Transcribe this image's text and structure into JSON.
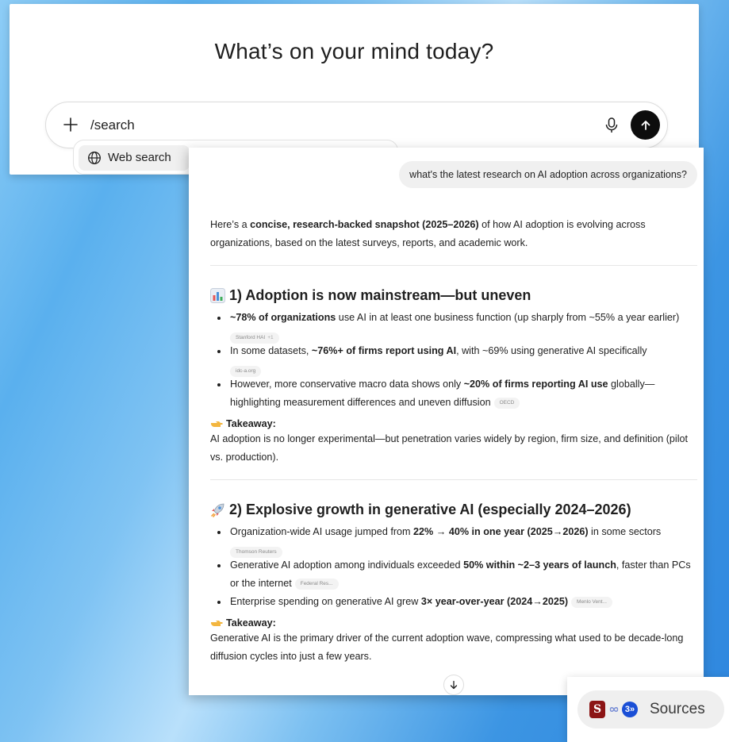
{
  "hero": {
    "title": "What’s on your mind today?"
  },
  "composer": {
    "value": "/search",
    "icons": [
      "plus-icon",
      "mic-icon",
      "arrow-up-icon"
    ]
  },
  "dropdown": {
    "item_label": "Web search",
    "item_icon": "globe-icon"
  },
  "chat": {
    "user_message": "what's the latest research on AI adoption across organizations?",
    "intro_pre": "Here’s a ",
    "intro_bold": "concise, research-backed snapshot (2025–2026)",
    "intro_post": " of how AI adoption is evolving across organizations, based on the latest surveys, reports, and academic work.",
    "section1": {
      "emoji": "bar-chart-icon",
      "title": "1) Adoption is now mainstream—but uneven",
      "b1_bold": "~78% of organizations",
      "b1_text": " use AI in at least one business function (up sharply from ~55% a year earlier)",
      "b1_source": "Stanford HAI",
      "b1_source_more": "+1",
      "b2_pre": "In some datasets, ",
      "b2_bold": "~76%+ of firms report using AI",
      "b2_post": ", with ~69% using generative AI specifically",
      "b2_source": "idc-a.org",
      "b3_pre": "However, more conservative macro data shows only ",
      "b3_bold": "~20% of firms reporting AI use",
      "b3_post": " globally—highlighting measurement differences and uneven diffusion",
      "b3_source": "OECD",
      "takeaway_label": "Takeaway:",
      "takeaway_text": "AI adoption is no longer experimental—but penetration varies widely by region, firm size, and definition (pilot vs. production)."
    },
    "section2": {
      "emoji": "rocket-icon",
      "title": "2) Explosive growth in generative AI (especially 2024–2026)",
      "b1_pre": "Organization-wide AI usage jumped from ",
      "b1_bold": "22% → 40% in one year (2025→2026)",
      "b1_post": " in some sectors",
      "b1_source": "Thomson Reuters",
      "b2_pre": "Generative AI adoption among individuals exceeded ",
      "b2_bold": "50% within ~2–3 years of launch",
      "b2_post": ", faster than PCs or the internet",
      "b2_source": "Federal Res...",
      "b3_pre": "Enterprise spending on generative AI grew ",
      "b3_bold": "3× year-over-year (2024→2025)",
      "b3_source": "Menlo Vent...",
      "takeaway_label": "Takeaway:",
      "takeaway_text": "Generative AI is the primary driver of the current adoption wave, compressing what used to be decade-long diffusion cycles into just a few years."
    }
  },
  "sources": {
    "label": "Sources",
    "stanford_letter": "S",
    "idc_glyph": "3»"
  }
}
